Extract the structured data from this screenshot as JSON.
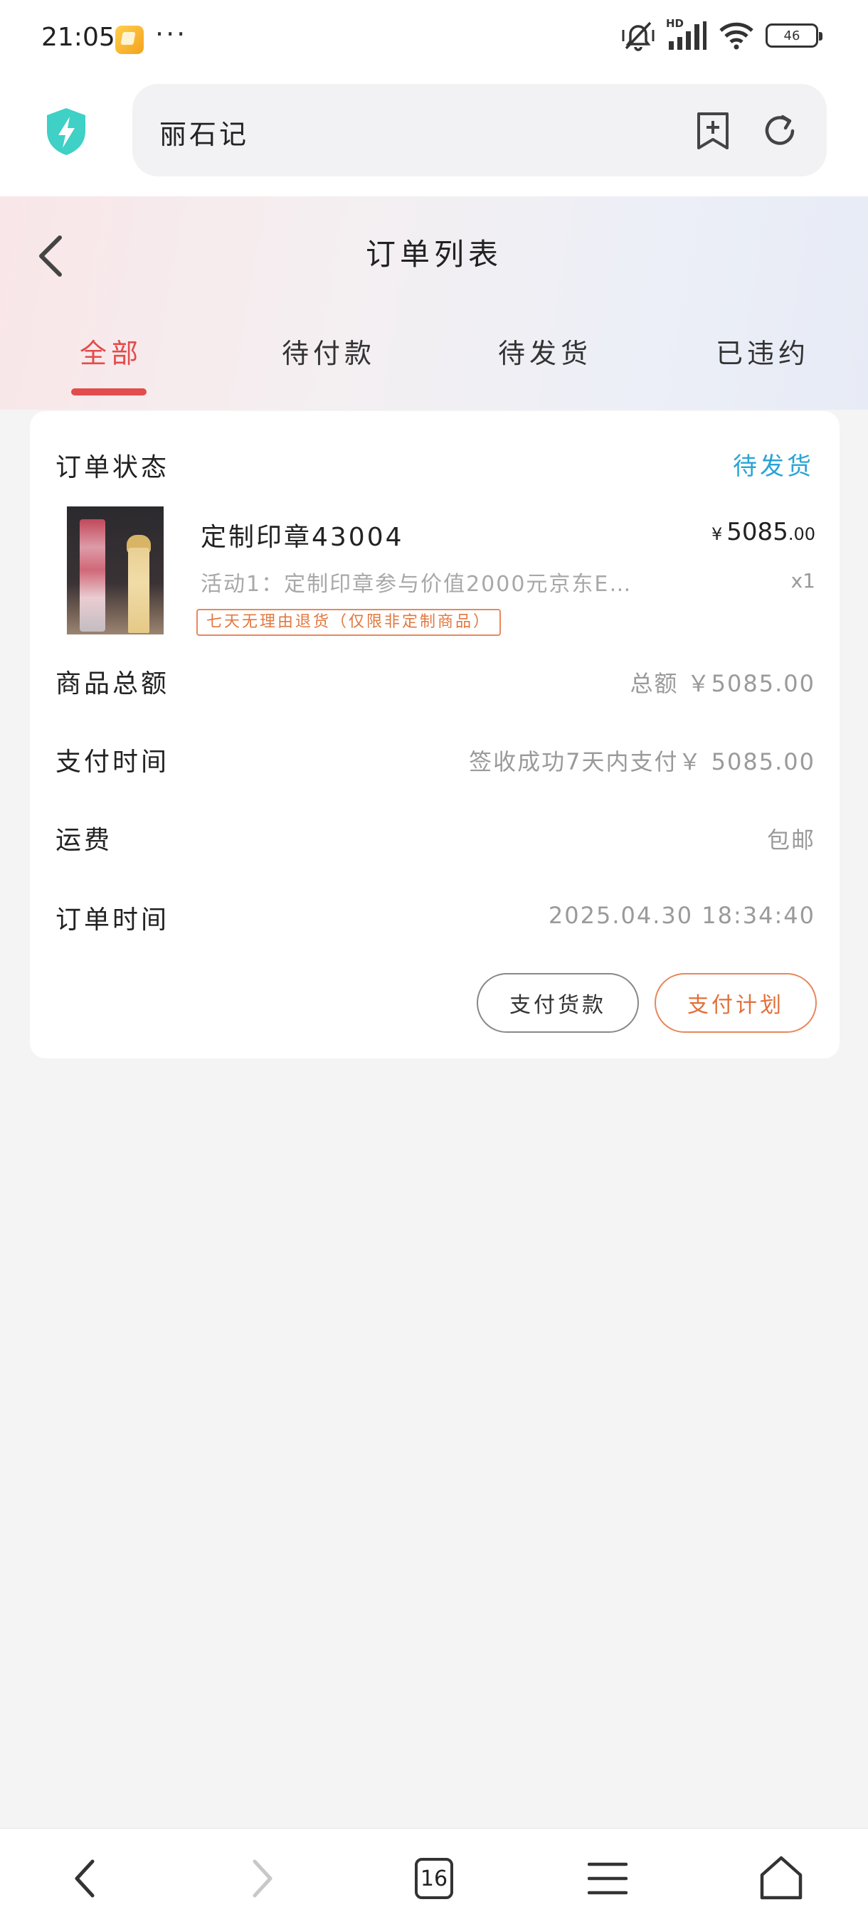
{
  "status_bar": {
    "time": "21:05",
    "dots": "···",
    "hd_label": "HD",
    "battery": "46"
  },
  "browser": {
    "url_text": "丽石记"
  },
  "page": {
    "title": "订单列表",
    "tabs": [
      {
        "label": "全部",
        "active": true
      },
      {
        "label": "待付款",
        "active": false
      },
      {
        "label": "待发货",
        "active": false
      },
      {
        "label": "已违约",
        "active": false
      }
    ]
  },
  "order": {
    "status_label": "订单状态",
    "status_value": "待发货",
    "product": {
      "name": "定制印章43004",
      "price_currency": "¥",
      "price_main": "5085",
      "price_decimal": ".00",
      "description": "活动1：定制印章参与价值2000元京东E…",
      "quantity": "x1",
      "return_policy": "七天无理由退货（仅限非定制商品）"
    },
    "rows": [
      {
        "label": "商品总额",
        "value": "总额 ￥5085.00"
      },
      {
        "label": "支付时间",
        "value": "签收成功7天内支付￥ 5085.00"
      },
      {
        "label": "运费",
        "value": "包邮"
      },
      {
        "label": "订单时间",
        "value": "2025.04.30 18:34:40"
      }
    ],
    "buttons": {
      "pay_goods": "支付货款",
      "pay_plan": "支付计划"
    }
  },
  "bottom_nav": {
    "tab_count": "16"
  },
  "colors": {
    "accent_red": "#e24c4c",
    "status_blue": "#2aa4d6",
    "orange": "#e2703a"
  }
}
